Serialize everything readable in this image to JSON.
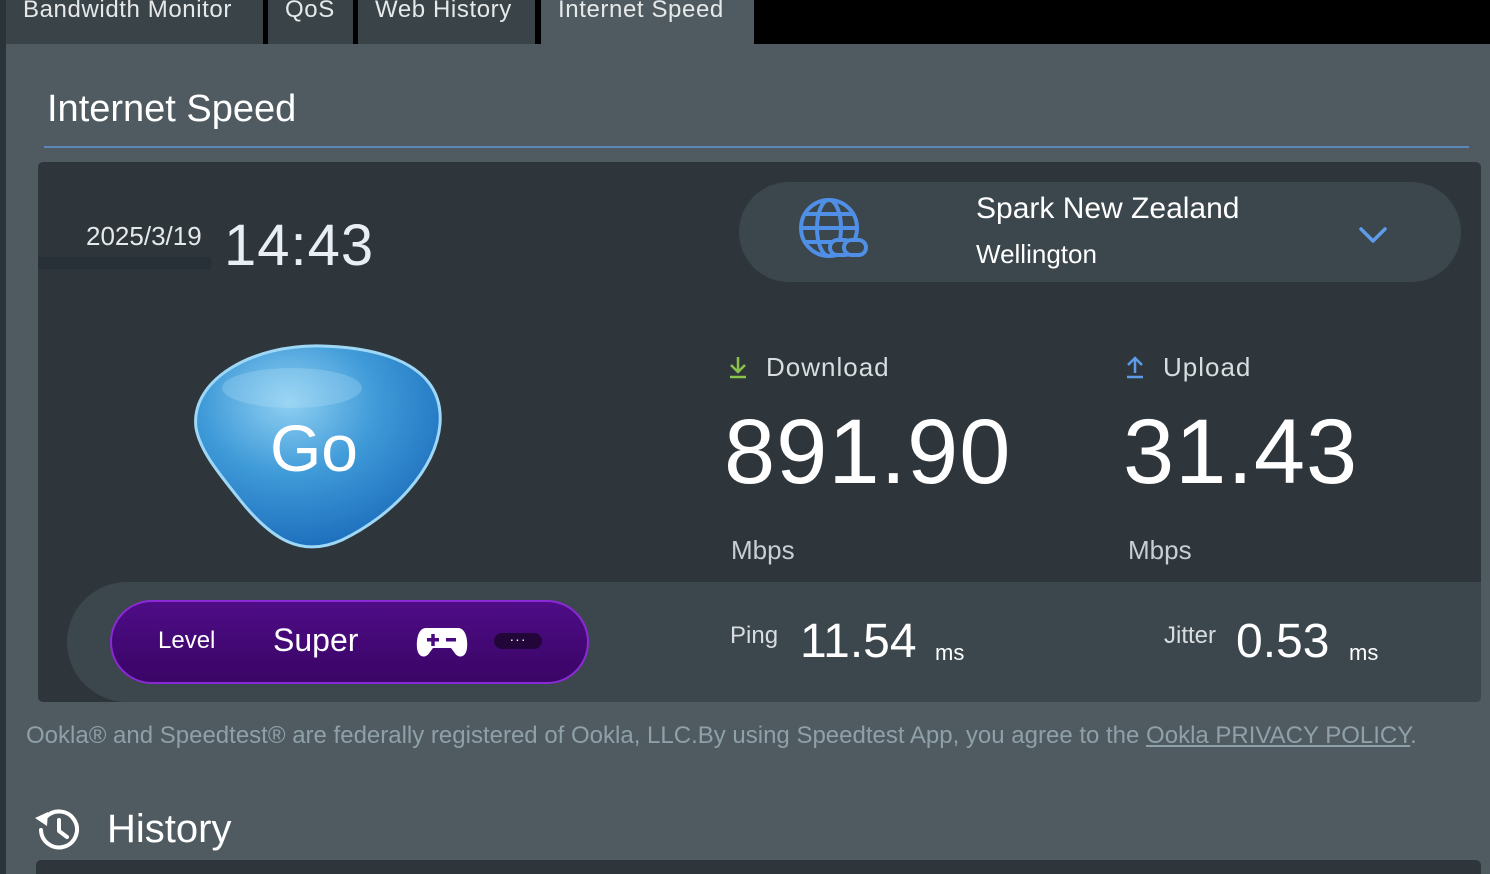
{
  "tabs": [
    {
      "label": "Bandwidth Monitor"
    },
    {
      "label": "QoS"
    },
    {
      "label": "Web History"
    },
    {
      "label": "Internet Speed"
    }
  ],
  "page_title": "Internet Speed",
  "test": {
    "date": "2025/3/19",
    "time": "14:43",
    "go_label": "Go"
  },
  "server": {
    "name": "Spark New Zealand",
    "city": "Wellington",
    "icon": "globe-link-icon"
  },
  "download": {
    "label": "Download",
    "value": "891.90",
    "unit": "Mbps",
    "icon": "download-arrow-icon"
  },
  "upload": {
    "label": "Upload",
    "value": "31.43",
    "unit": "Mbps",
    "icon": "upload-arrow-icon"
  },
  "ping": {
    "label": "Ping",
    "value": "11.54",
    "unit": "ms"
  },
  "jitter": {
    "label": "Jitter",
    "value": "0.53",
    "unit": "ms"
  },
  "level": {
    "label": "Level",
    "value": "Super",
    "more": "···"
  },
  "disclaimer": {
    "text": "Ookla® and Speedtest® are federally registered of Ookla, LLC.By using Speedtest App, you agree to the ",
    "link": "Ookla PRIVACY POLICY",
    "suffix": "."
  },
  "history": {
    "title": "History"
  },
  "colors": {
    "accent_blue": "#5d9ce8",
    "download_green": "#8bc34a",
    "level_purple": "#4e0c86"
  }
}
